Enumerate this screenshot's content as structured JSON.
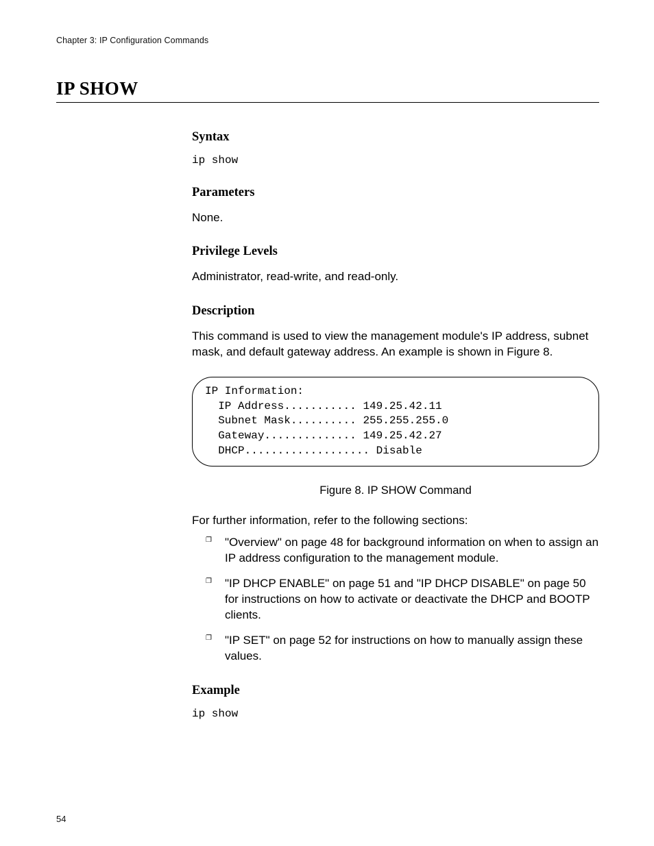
{
  "header": {
    "running_head": "Chapter 3: IP Configuration Commands"
  },
  "title": "IP SHOW",
  "sections": {
    "syntax": {
      "heading": "Syntax",
      "code": "ip show"
    },
    "parameters": {
      "heading": "Parameters",
      "text": "None."
    },
    "privilege": {
      "heading": "Privilege Levels",
      "text": "Administrator, read-write, and read-only."
    },
    "description": {
      "heading": "Description",
      "intro": "This command is used to view the management module's IP address, subnet mask, and default gateway address. An example is shown in Figure 8.",
      "output_lines": "IP Information:\n  IP Address........... 149.25.42.11\n  Subnet Mask.......... 255.255.255.0\n  Gateway.............. 149.25.42.27\n  DHCP................... Disable",
      "figure_caption": "Figure 8. IP SHOW Command",
      "further_intro": "For further information, refer to the following sections:",
      "bullets": [
        "\"Overview\" on page 48 for background information on when to assign an IP address configuration to the management module.",
        "\"IP DHCP ENABLE\" on page 51 and \"IP DHCP DISABLE\" on page 50 for instructions on how to activate or deactivate the DHCP and BOOTP clients.",
        "\"IP SET\" on page 52 for instructions on how to manually assign these values."
      ]
    },
    "example": {
      "heading": "Example",
      "code": "ip show"
    }
  },
  "page_number": "54"
}
